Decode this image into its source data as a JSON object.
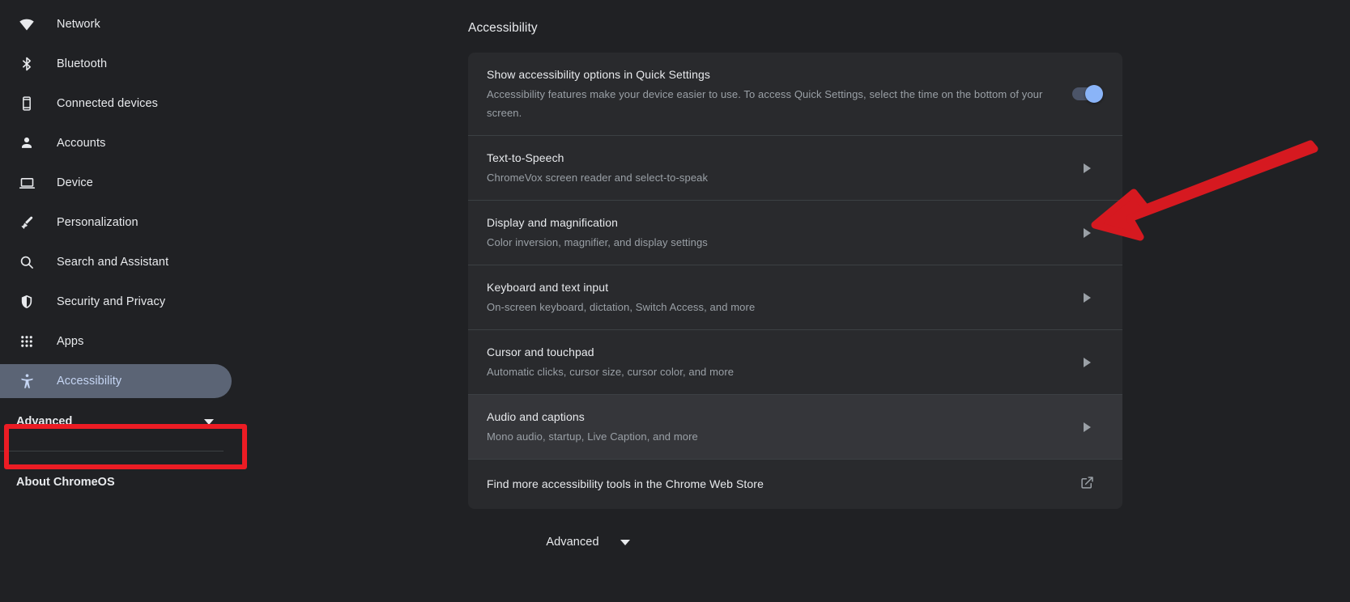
{
  "sidebar": {
    "items": [
      {
        "label": "Network",
        "icon": "wifi-icon",
        "name": "sidebar-item-network",
        "selected": false
      },
      {
        "label": "Bluetooth",
        "icon": "bluetooth-icon",
        "name": "sidebar-item-bluetooth",
        "selected": false
      },
      {
        "label": "Connected devices",
        "icon": "phone-icon",
        "name": "sidebar-item-connected-devices",
        "selected": false
      },
      {
        "label": "Accounts",
        "icon": "person-icon",
        "name": "sidebar-item-accounts",
        "selected": false
      },
      {
        "label": "Device",
        "icon": "laptop-icon",
        "name": "sidebar-item-device",
        "selected": false
      },
      {
        "label": "Personalization",
        "icon": "paintbrush-icon",
        "name": "sidebar-item-personalization",
        "selected": false
      },
      {
        "label": "Search and Assistant",
        "icon": "search-icon",
        "name": "sidebar-item-search-assistant",
        "selected": false
      },
      {
        "label": "Security and Privacy",
        "icon": "shield-icon",
        "name": "sidebar-item-security-privacy",
        "selected": false
      },
      {
        "label": "Apps",
        "icon": "grid-apps-icon",
        "name": "sidebar-item-apps",
        "selected": false
      },
      {
        "label": "Accessibility",
        "icon": "accessibility-icon",
        "name": "sidebar-item-accessibility",
        "selected": true
      }
    ],
    "advanced_label": "Advanced",
    "advanced_icon": "chevron-down-icon",
    "about_label": "About ChromeOS"
  },
  "main": {
    "page_title": "Accessibility",
    "rows": [
      {
        "title": "Show accessibility options in Quick Settings",
        "subtitle": "Accessibility features make your device easier to use. To access Quick Settings, select the time on the bottom of your screen.",
        "control": "toggle",
        "toggle_on": true,
        "hovered": false,
        "name": "row-show-accessibility-options"
      },
      {
        "title": "Text-to-Speech",
        "subtitle": "ChromeVox screen reader and select-to-speak",
        "control": "chevron",
        "hovered": false,
        "name": "row-text-to-speech"
      },
      {
        "title": "Display and magnification",
        "subtitle": "Color inversion, magnifier, and display settings",
        "control": "chevron",
        "hovered": false,
        "name": "row-display-and-magnification"
      },
      {
        "title": "Keyboard and text input",
        "subtitle": "On-screen keyboard, dictation, Switch Access, and more",
        "control": "chevron",
        "hovered": false,
        "name": "row-keyboard-and-text-input"
      },
      {
        "title": "Cursor and touchpad",
        "subtitle": "Automatic clicks, cursor size, cursor color, and more",
        "control": "chevron",
        "hovered": false,
        "name": "row-cursor-and-touchpad"
      },
      {
        "title": "Audio and captions",
        "subtitle": "Mono audio, startup, Live Caption, and more",
        "control": "chevron",
        "hovered": true,
        "name": "row-audio-and-captions"
      },
      {
        "title": "Find more accessibility tools in the Chrome Web Store",
        "subtitle": "",
        "control": "external-link",
        "hovered": false,
        "name": "row-find-more-tools"
      }
    ],
    "bottom_advanced_label": "Advanced",
    "bottom_advanced_icon": "chevron-down-icon"
  },
  "annotations": {
    "highlight_color": "#ec1c24",
    "arrow_color": "#d61920",
    "box_target": "sidebar-item-accessibility",
    "arrow_target": "row-display-and-magnification"
  },
  "colors": {
    "page_background": "#202124",
    "card_background": "#292a2d",
    "row_hover": "#35363a",
    "selected_pill": "#5b6475",
    "accent_blue": "#8ab4f8",
    "text_primary": "#e8eaed",
    "text_secondary": "#9aa0a6",
    "divider": "#3c4043"
  }
}
